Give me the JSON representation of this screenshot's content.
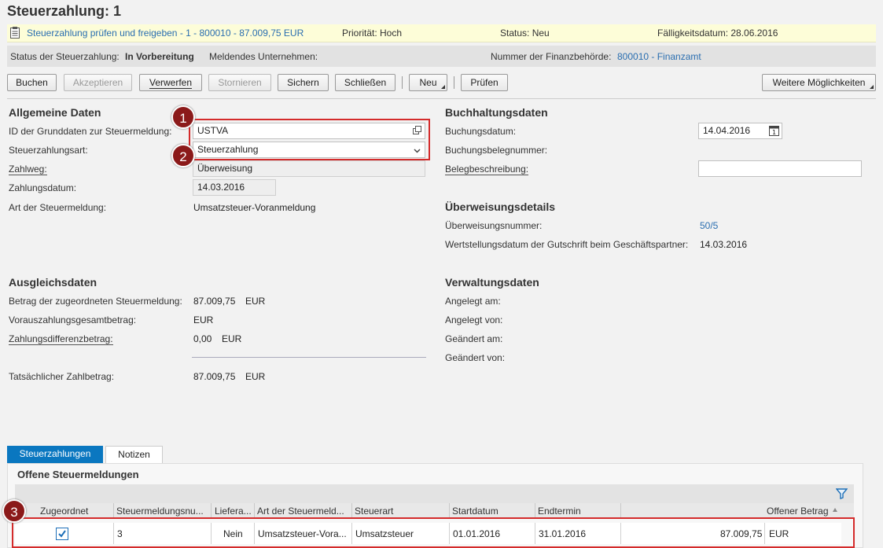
{
  "title": "Steuerzahlung: 1",
  "notice": {
    "task_link": "Steuerzahlung prüfen und freigeben - 1 - 800010 - 87.009,75 EUR",
    "priority": "Priorität: Hoch",
    "status": "Status: Neu",
    "due": "Fälligkeitsdatum: 28.06.2016"
  },
  "statusbar": {
    "status_label": "Status der Steuerzahlung:",
    "status_value": "In Vorbereitung",
    "company_label": "Meldendes Unternehmen:",
    "authority_label": "Nummer der Finanzbehörde:",
    "authority_value": "800010 - Finanzamt"
  },
  "toolbar": {
    "buchen": "Buchen",
    "akzeptieren": "Akzeptieren",
    "verwerfen": "Verwerfen",
    "stornieren": "Stornieren",
    "sichern": "Sichern",
    "schliessen": "Schließen",
    "neu": "Neu",
    "pruefen": "Prüfen",
    "weitere": "Weitere Möglichkeiten"
  },
  "allgemein": {
    "heading": "Allgemeine Daten",
    "id_label": "ID der Grunddaten zur Steuermeldung:",
    "id_value": "USTVA",
    "art_label": "Steuerzahlungsart:",
    "art_value": "Steuerzahlung",
    "zahlweg_label": "Zahlweg:",
    "zahlweg_value": "Überweisung",
    "datum_label": "Zahlungsdatum:",
    "datum_value": "14.03.2016",
    "meldung_label": "Art der Steuermeldung:",
    "meldung_value": "Umsatzsteuer-Voranmeldung"
  },
  "buchhaltung": {
    "heading": "Buchhaltungsdaten",
    "buchungsdatum_label": "Buchungsdatum:",
    "buchungsdatum_value": "14.04.2016",
    "belegnummer_label": "Buchungsbelegnummer:",
    "belegbeschreibung_label": "Belegbeschreibung:"
  },
  "ueberweisung": {
    "heading": "Überweisungsdetails",
    "nummer_label": "Überweisungsnummer:",
    "nummer_value": "50/5",
    "wert_label": "Wertstellungsdatum der Gutschrift beim Geschäftspartner:",
    "wert_value": "14.03.2016"
  },
  "ausgleich": {
    "heading": "Ausgleichsdaten",
    "betrag_label": "Betrag der zugeordneten Steuermeldung:",
    "betrag_value": "87.009,75",
    "betrag_cur": "EUR",
    "voraus_label": "Vorauszahlungsgesamtbetrag:",
    "voraus_cur": "EUR",
    "diff_label": "Zahlungsdifferenzbetrag:",
    "diff_value": "0,00",
    "diff_cur": "EUR",
    "tats_label": "Tatsächlicher Zahlbetrag:",
    "tats_value": "87.009,75",
    "tats_cur": "EUR"
  },
  "verwaltung": {
    "heading": "Verwaltungsdaten",
    "angelegt_am": "Angelegt am:",
    "angelegt_von": "Angelegt von:",
    "geaendert_am": "Geändert am:",
    "geaendert_von": "Geändert von:"
  },
  "tabs": {
    "steuerzahlungen": "Steuerzahlungen",
    "notizen": "Notizen"
  },
  "table": {
    "heading": "Offene Steuermeldungen",
    "columns": [
      "Zugeordnet",
      "Steuermeldungsnu...",
      "Liefera...",
      "Art der Steuermeld...",
      "Steuerart",
      "Startdatum",
      "Endtermin",
      "Offener Betrag"
    ],
    "row": {
      "nummer": "3",
      "liefera": "Nein",
      "art": "Umsatzsteuer-Vora...",
      "steuerart": "Umsatzsteuer",
      "start": "01.01.2016",
      "end": "31.01.2016",
      "betrag": "87.009,75",
      "cur": "EUR"
    }
  },
  "badges": [
    "1",
    "2",
    "3"
  ],
  "colors": {
    "accent": "#2a6eb0",
    "tab_active": "#0a77c0",
    "annotation": "#d42b2b"
  }
}
